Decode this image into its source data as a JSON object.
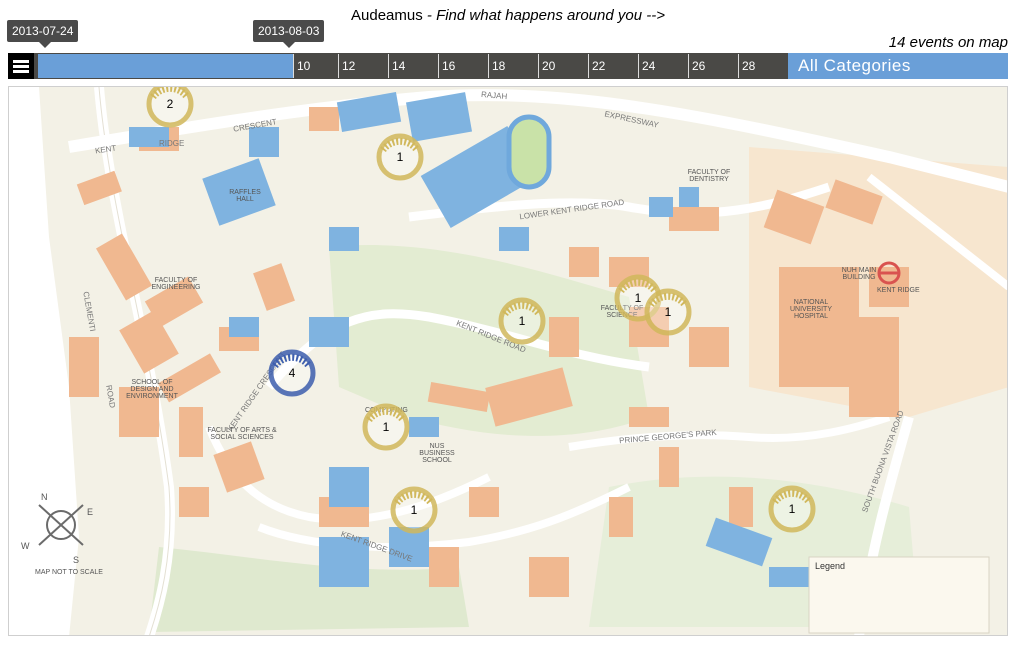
{
  "header": {
    "app_name": "Audeamus",
    "tagline": " - Find what happens around you -->",
    "events_count": "14 events on map"
  },
  "timeline": {
    "start_date": "2013-07-24",
    "end_date": "2013-08-03",
    "ticks": [
      "10",
      "12",
      "14",
      "16",
      "18",
      "20",
      "22",
      "24",
      "26",
      "28"
    ],
    "selected_range_fraction": [
      0,
      0.33
    ]
  },
  "category_filter": {
    "selected": "All Categories"
  },
  "map": {
    "labels": {
      "rajah": "RAJAH",
      "expressway": "EXPRESSWAY",
      "kent_ridge": "KENT",
      "ridge": "RIDGE",
      "crescent": "CRESCENT",
      "lower_kent_ridge_road": "LOWER KENT RIDGE ROAD",
      "kent_ridge_road": "KENT RIDGE ROAD",
      "kent_ridge_crescent": "KENT RIDGE CRESCENT",
      "kent_ridge_drive": "KENT RIDGE DRIVE",
      "prince_georges_park": "PRINCE GEORGE'S PARK",
      "south_buona_vista_road": "SOUTH BUONA VISTA ROAD",
      "clementi_road": "CLEMENTI",
      "road": "ROAD",
      "faculty_of_engineering": "FACULTY OF ENGINEERING",
      "faculty_of_science": "FACULTY OF SCIENCE",
      "faculty_of_dentistry": "FACULTY OF DENTISTRY",
      "school_of_design": "SCHOOL OF DESIGN AND ENVIRONMENT",
      "faculty_of_arts": "FACULTY OF ARTS & SOCIAL SCIENCES",
      "nus_business_school": "NUS BUSINESS SCHOOL",
      "computing": "COMPUTING",
      "nuh": "NATIONAL UNIVERSITY HOSPITAL",
      "nuh_main_building": "NUH MAIN BUILDING",
      "raffles_hall": "RAFFLES HALL",
      "kent_ridge_mrt": "KENT RIDGE",
      "map_not_to_scale": "MAP NOT TO SCALE",
      "legend_title": "Legend",
      "compass_n": "N",
      "compass_e": "E",
      "compass_s": "S",
      "compass_w": "W"
    },
    "clusters": [
      {
        "count": "2",
        "color": "#d1b85c"
      },
      {
        "count": "1",
        "color": "#d1b85c"
      },
      {
        "count": "1",
        "color": "#d1b85c"
      },
      {
        "count": "1",
        "color": "#d1b85c"
      },
      {
        "count": "1",
        "color": "#d1b85c"
      },
      {
        "count": "4",
        "color": "#3e5fae"
      },
      {
        "count": "1",
        "color": "#d1b85c"
      },
      {
        "count": "1",
        "color": "#d1b85c"
      },
      {
        "count": "1",
        "color": "#d1b85c"
      }
    ]
  },
  "colors": {
    "timeline_bg": "#4a4946",
    "accent_blue": "#6a9fd8",
    "map_bg": "#f3f1e6",
    "building_orange": "#f0b890",
    "building_blue": "#7fb3e0",
    "green_area": "#d6e6c8"
  }
}
